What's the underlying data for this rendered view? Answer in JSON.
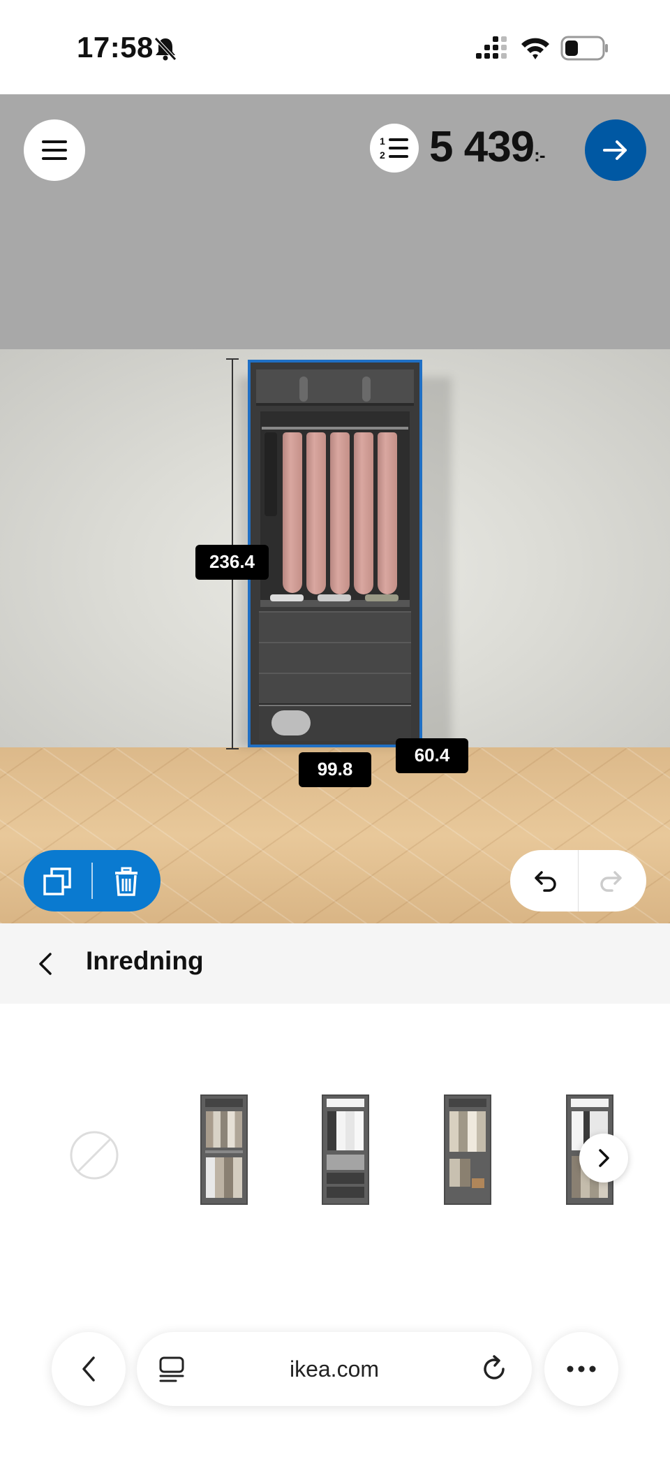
{
  "status_bar": {
    "time": "17:58",
    "battery_percent": 30
  },
  "header": {
    "price_main": "5 439",
    "price_suffix": ":-"
  },
  "dimensions": {
    "height": "236.4",
    "width": "99.8",
    "depth": "60.4"
  },
  "section": {
    "title": "Inredning"
  },
  "options": {
    "items": [
      "no-interior",
      "interior-option-1",
      "interior-option-2",
      "interior-option-3",
      "interior-option-4"
    ]
  },
  "browser": {
    "url": "ikea.com"
  },
  "colors": {
    "accent_blue": "#0058a3",
    "selection_blue": "#1f6fc4",
    "edit_pill_blue": "#0a7ad0"
  }
}
